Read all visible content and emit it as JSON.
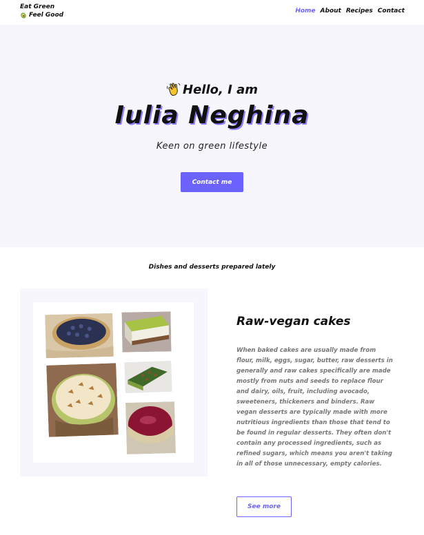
{
  "brand": {
    "line1": "Eat Green",
    "line2": "Feel Good",
    "icon": "avocado-icon"
  },
  "nav": {
    "items": [
      {
        "label": "Home",
        "active": true
      },
      {
        "label": "About",
        "active": false
      },
      {
        "label": "Recipes",
        "active": false
      },
      {
        "label": "Contact",
        "active": false
      }
    ]
  },
  "hero": {
    "greeting": "Hello, I am",
    "greeting_icon": "waving-hand-icon",
    "name": "Iulia Neghina",
    "tagline": "Keen on green lifestyle",
    "cta_label": "Contact me"
  },
  "section": {
    "title": "Dishes and desserts prepared lately"
  },
  "card": {
    "title": "Raw-vegan cakes",
    "text": "When baked cakes are usually made from flour, milk, eggs, sugar, butter, raw desserts in generally and raw cakes specifically are made mostly from nuts and seeds to replace flour and dairy, oils, fruit, including avocado, sweeteners, thickeners and binders. Raw vegan desserts are typically made with more nutritious ingredients than those that tend to be found in regular desserts. They often don't contain any processed ingredients, such as refined sugars, which means you aren't taking in all of those unnecessary, empty calories.",
    "button_label": "See more"
  },
  "colors": {
    "accent": "#6c63ff",
    "hero_bg": "#f7f6fd",
    "body_text_muted": "#777777"
  }
}
